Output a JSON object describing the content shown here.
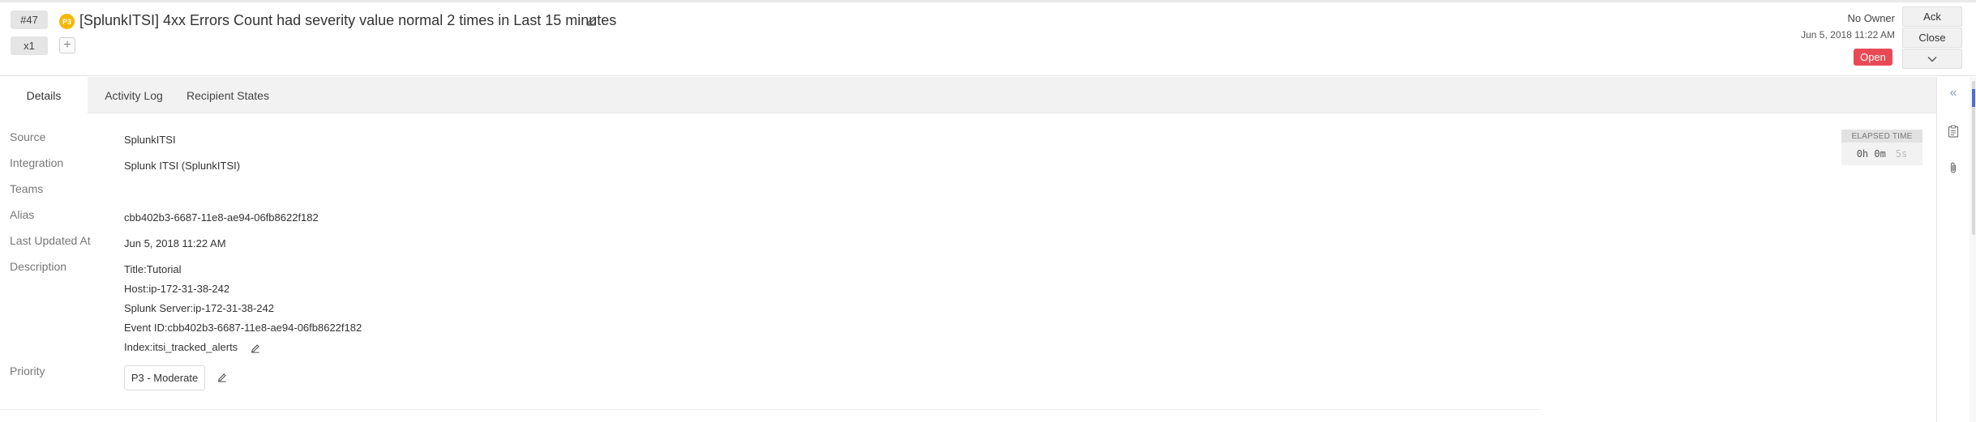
{
  "alert": {
    "id": "#47",
    "count": "x1",
    "priority_badge": "P3",
    "title": "[SplunkITSI] 4xx Errors Count had severity value normal 2 times in Last 15 minutes",
    "owner": "No Owner",
    "created": "Jun 5, 2018 11:22 AM",
    "status": "Open"
  },
  "actions": {
    "ack": "Ack",
    "close": "Close",
    "more_icon": "chevron-down-icon"
  },
  "tabs": [
    {
      "label": "Details"
    },
    {
      "label": "Activity Log"
    },
    {
      "label": "Recipient States"
    }
  ],
  "details": {
    "source_label": "Source",
    "source_value": "SplunkITSI",
    "integration_label": "Integration",
    "integration_value": "Splunk ITSI (SplunkITSI)",
    "teams_label": "Teams",
    "alias_label": "Alias",
    "alias_value": "cbb402b3-6687-11e8-ae94-06fb8622f182",
    "updated_label": "Last Updated At",
    "updated_value": "Jun 5, 2018 11:22 AM",
    "description_label": "Description",
    "description_lines": [
      "Title:Tutorial",
      "Host:ip-172-31-38-242",
      "Splunk Server:ip-172-31-38-242",
      "Event ID:cbb402b3-6687-11e8-ae94-06fb8622f182",
      "Index:itsi_tracked_alerts"
    ],
    "priority_label": "Priority",
    "priority_value": "P3 - Moderate"
  },
  "elapsed": {
    "label": "ELAPSED TIME",
    "hours_minutes": "0h 0m",
    "seconds": "5s"
  },
  "colors": {
    "status_open": "#e84a55",
    "p3": "#f5b800",
    "accent": "#4b6fd6"
  }
}
